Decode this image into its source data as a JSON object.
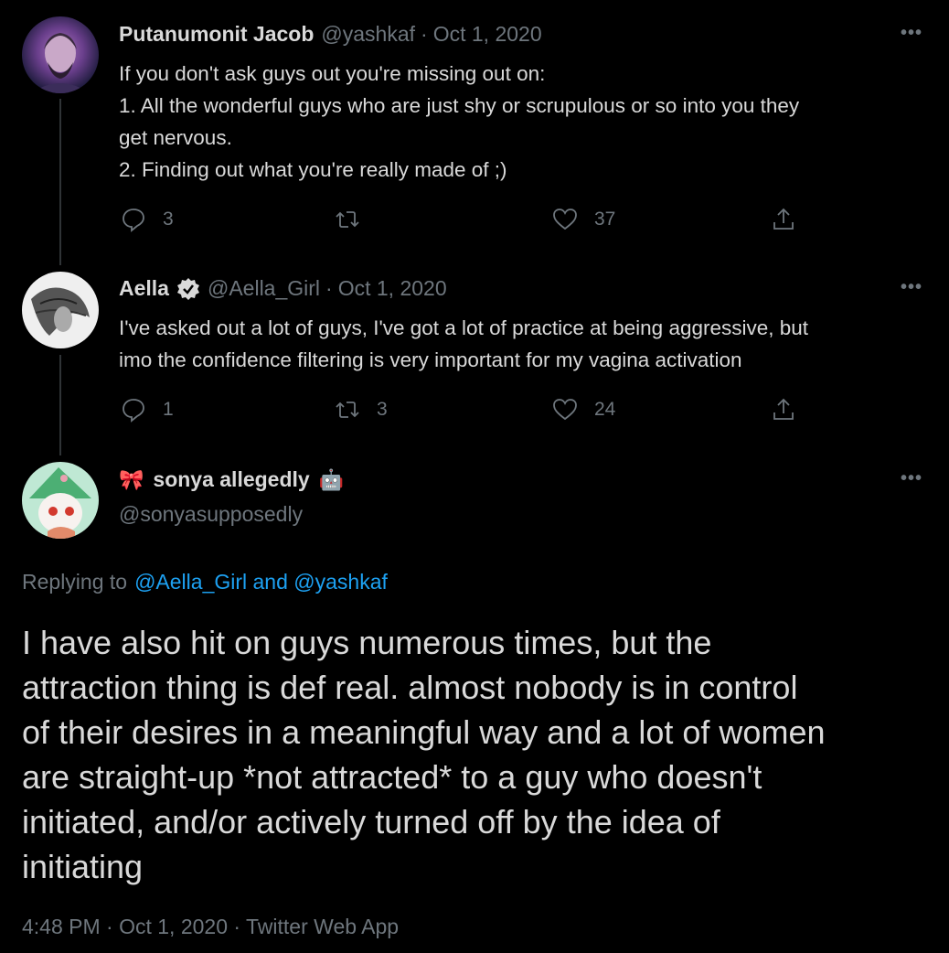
{
  "tweets": [
    {
      "name": "Putanumonit Jacob",
      "handle": "@yashkaf",
      "sep": "·",
      "date": "Oct 1, 2020",
      "lines": [
        "If you don't ask guys out you're missing out on:",
        "1. All the wonderful guys who are just shy or scrupulous or so into you they",
        "get nervous.",
        "2. Finding out what you're really made of ;)"
      ],
      "reply_count": "3",
      "retweet_count": "",
      "like_count": "37"
    },
    {
      "name": "Aella",
      "handle": "@Aella_Girl",
      "sep": "·",
      "date": "Oct 1, 2020",
      "lines": [
        "I've asked out a lot of guys, I've got a lot of practice at being aggressive, but",
        "imo the confidence filtering is very important for my vagina activation"
      ],
      "reply_count": "1",
      "retweet_count": "3",
      "like_count": "24"
    }
  ],
  "main_tweet": {
    "name_prefix_emoji": "🎀",
    "name": "sonya allegedly",
    "name_suffix_emoji": "🤖",
    "handle": "@sonyasupposedly",
    "replying_label": "Replying to",
    "replying_to": "@Aella_Girl and @yashkaf",
    "lines": [
      "I have also hit on guys numerous times, but the",
      "attraction thing is def real. almost nobody is in control",
      "of their desires in a meaningful way and a lot of women",
      "are straight-up *not attracted* to a guy who doesn't",
      "initiated, and/or actively turned off by the idea of",
      "initiating"
    ],
    "timestamp": "4:48 PM · Oct 1, 2020 · Twitter Web App"
  },
  "icons": {
    "more": "more-horizontal-icon",
    "reply": "reply-bubble-icon",
    "retweet": "retweet-icon",
    "like": "heart-icon",
    "share": "share-icon",
    "verified": "verified-badge-icon"
  },
  "colors": {
    "background": "#000000",
    "text": "#d9d9d9",
    "secondary": "#6e767d",
    "link": "#1da1f2"
  },
  "more_glyph": "•••"
}
